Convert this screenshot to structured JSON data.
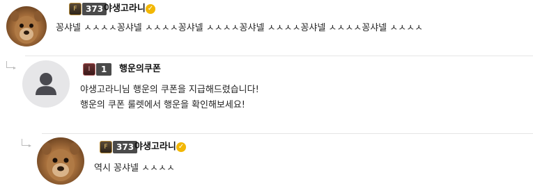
{
  "comments": [
    {
      "level": "373",
      "nickname": "야생고라니",
      "text": "꽁샤넬 ㅅㅅㅅㅅ꽁샤넬 ㅅㅅㅅㅅ꽁샤넬 ㅅㅅㅅㅅ꽁샤넬 ㅅㅅㅅㅅ꽁샤넬 ㅅㅅㅅㅅ꽁샤넬 ㅅㅅㅅㅅ"
    },
    {
      "level": "1",
      "nickname": "행운의쿠폰",
      "text_line1": "야생고라니님 행운의 쿠폰을 지급해드렸습니다!",
      "text_line2": "행운의 쿠폰 룰렛에서 행운을 확인해보세요!"
    },
    {
      "level": "373",
      "nickname": "야생고라니",
      "text": "역시 꽁샤넬 ㅅㅅㅅㅅ"
    }
  ],
  "icons": {
    "level_badge": "level-badge-icon",
    "verified": "verified-check-icon",
    "reply": "reply-arrow-icon",
    "default_avatar": "person-silhouette-icon"
  }
}
